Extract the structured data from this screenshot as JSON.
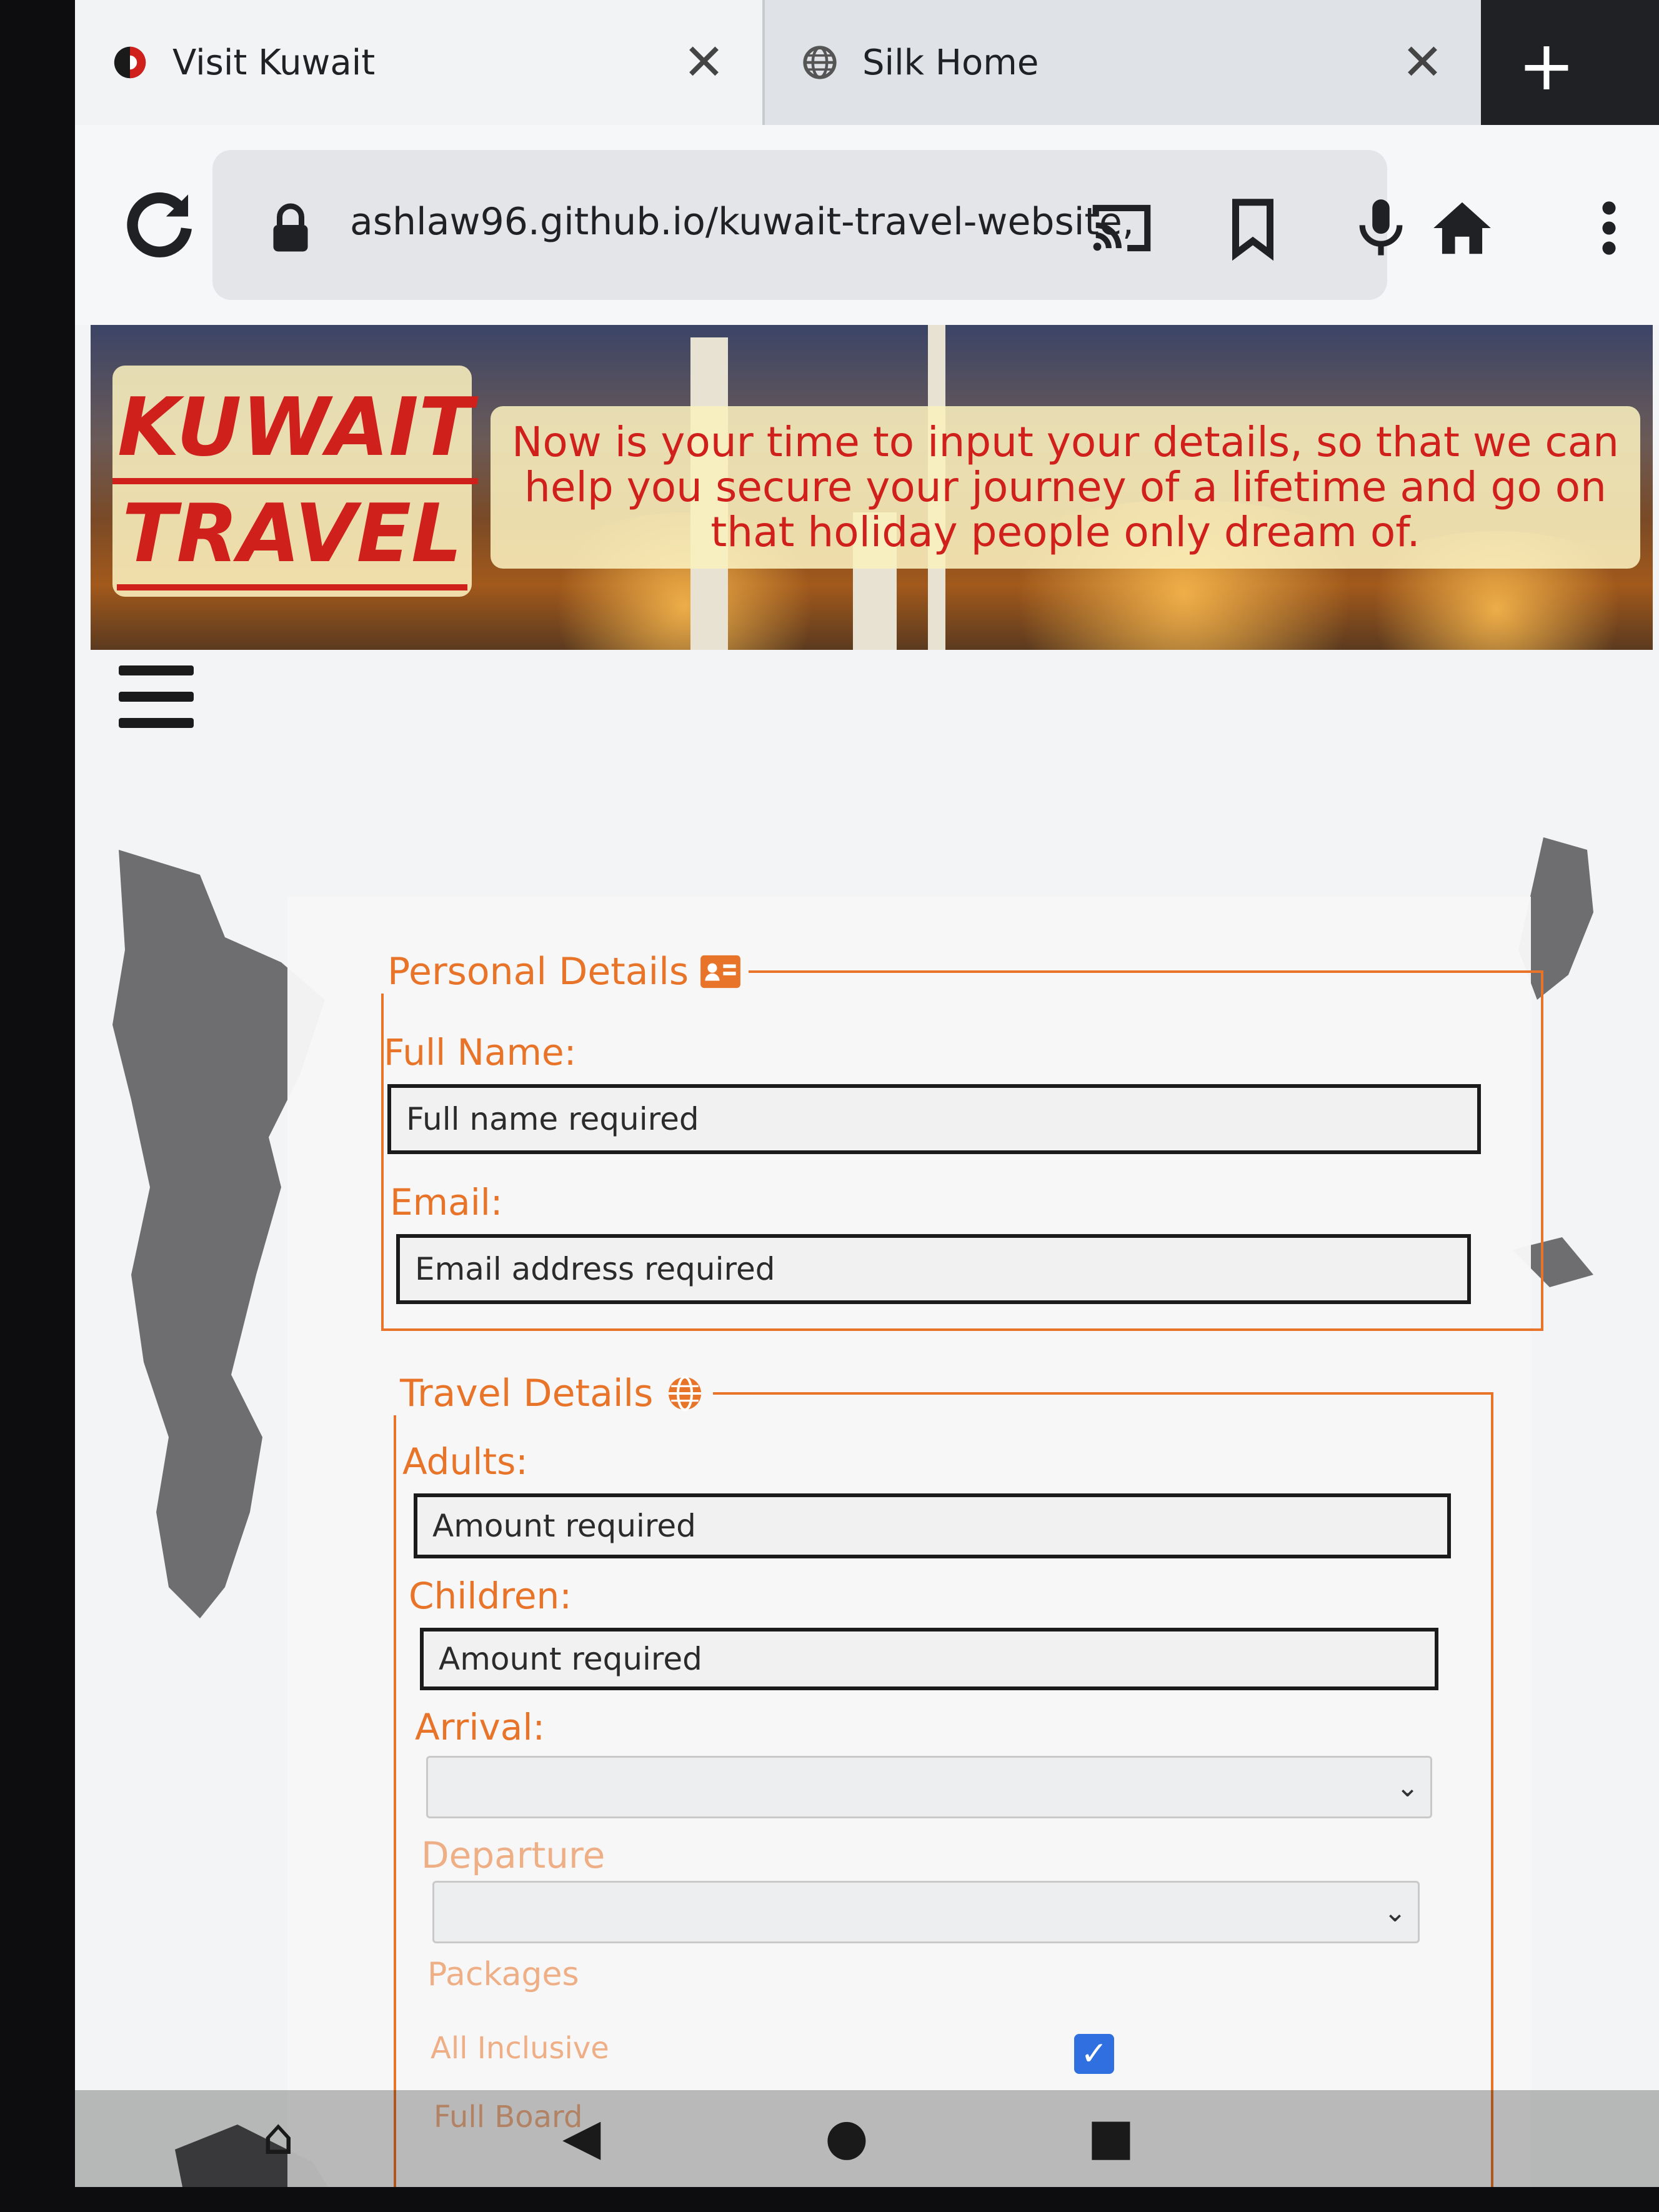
{
  "browser": {
    "tabs": [
      {
        "title": "Visit Kuwait",
        "favicon": "kuwait-flag-icon",
        "close": "✕"
      },
      {
        "title": "Silk Home",
        "favicon": "globe-icon",
        "close": "✕"
      }
    ],
    "new_tab": "+",
    "url": "ashlaw96.github.io/kuwait-travel-website,"
  },
  "header": {
    "logo_line1": "KUWAIT",
    "logo_line2": "TRAVEL",
    "tagline": "Now is your time to input your details, so that we can help you secure your journey of a lifetime and go on that holiday people only dream of."
  },
  "form": {
    "personal": {
      "legend": "Personal Details",
      "full_name_label": "Full Name:",
      "full_name_placeholder": "Full name required",
      "email_label": "Email:",
      "email_placeholder": "Email address required"
    },
    "travel": {
      "legend": "Travel Details",
      "adults_label": "Adults:",
      "adults_placeholder": "Amount required",
      "children_label": "Children:",
      "children_placeholder": "Amount required",
      "arrival_label": "Arrival:",
      "departure_label": "Departure",
      "packages_label": "Packages",
      "all_inclusive_label": "All Inclusive",
      "full_board_label": "Full Board"
    }
  },
  "colors": {
    "accent": "#e8742a",
    "brand_red": "#d0201c",
    "checkbox": "#2f6fe0"
  }
}
